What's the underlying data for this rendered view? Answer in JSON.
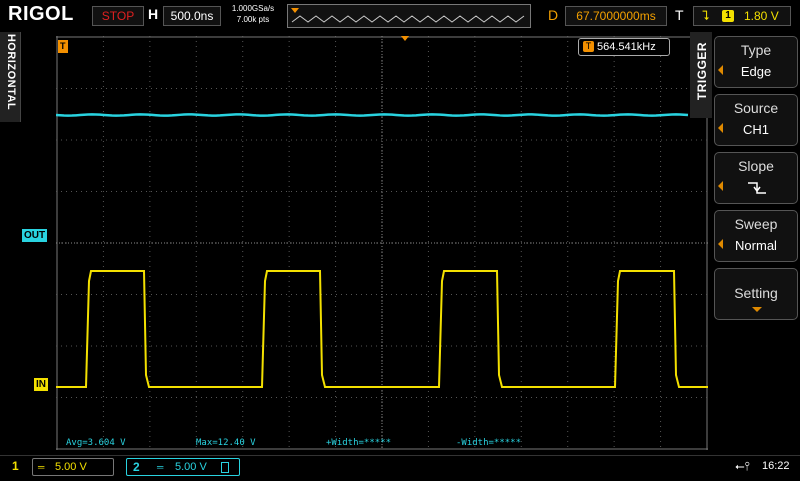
{
  "topbar": {
    "brand": "RIGOL",
    "run_status": "STOP",
    "horizontal_label": "H",
    "timebase": "500.0ns",
    "sample_rate": "1.000GSa/s",
    "memory_depth": "7.00k pts",
    "delay_label": "D",
    "delay": "67.7000000ms",
    "trigger_label": "T",
    "trigger_source_num": "1",
    "trigger_level": "1.80 V"
  },
  "left_tab": {
    "label": "HORIZONTAL"
  },
  "right_menu": {
    "tab_label": "TRIGGER",
    "items": [
      {
        "title": "Type",
        "value": "Edge"
      },
      {
        "title": "Source",
        "value": "CH1"
      },
      {
        "title": "Slope",
        "value": "falling-edge-icon"
      },
      {
        "title": "Sweep",
        "value": "Normal"
      },
      {
        "title": "Setting",
        "value": ""
      }
    ]
  },
  "display": {
    "frequency": "564.541kHz",
    "marker_trigger": "T",
    "marker_out": "OUT",
    "marker_in": "IN"
  },
  "measurements": {
    "avg": "Avg=3.604 V",
    "max": "Max=12.40 V",
    "pos_width": "+Width=*****",
    "neg_width": "-Width=*****"
  },
  "channels": [
    {
      "num": "1",
      "scale": "5.00 V",
      "color": "#f3e000"
    },
    {
      "num": "2",
      "scale": "5.00 V",
      "color": "#29d3e0"
    }
  ],
  "status": {
    "time": "16:22",
    "usb_icon": "usb-icon"
  },
  "colors": {
    "ch1": "#f3e000",
    "ch2": "#29d3e0",
    "trigger": "#f39000"
  }
}
